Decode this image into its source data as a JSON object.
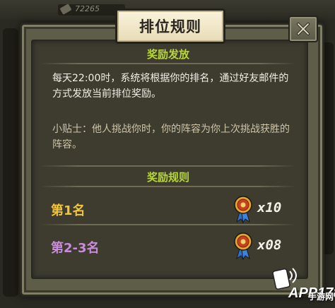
{
  "background": {
    "counter_value": "72265"
  },
  "dialog": {
    "title": "排位规则",
    "close_glyph": "✕"
  },
  "reward_distribution": {
    "header": "奖励发放",
    "main_text": "每天22:00时，系统将根据你的排名，通过好友邮件的方式发放当前排位奖励。",
    "tip_text": "小贴士：他人挑战你时，你的阵容为你上次挑战获胜的阵容。"
  },
  "reward_rules": {
    "header": "奖励规则",
    "rows": [
      {
        "rank_label": "第1名",
        "quantity": "x10",
        "icon": "medal-icon"
      },
      {
        "rank_label": "第2-3名",
        "quantity": "x08",
        "icon": "medal-icon"
      }
    ]
  },
  "colors": {
    "header_green": "#b7d63a",
    "rank1_gold": "#f0c53a",
    "rank2_purple": "#c98cdb",
    "body_text": "#f2efe6",
    "tip_text": "#cfc4a8"
  },
  "watermark": {
    "text": "APP178",
    "sub": "手游网"
  }
}
